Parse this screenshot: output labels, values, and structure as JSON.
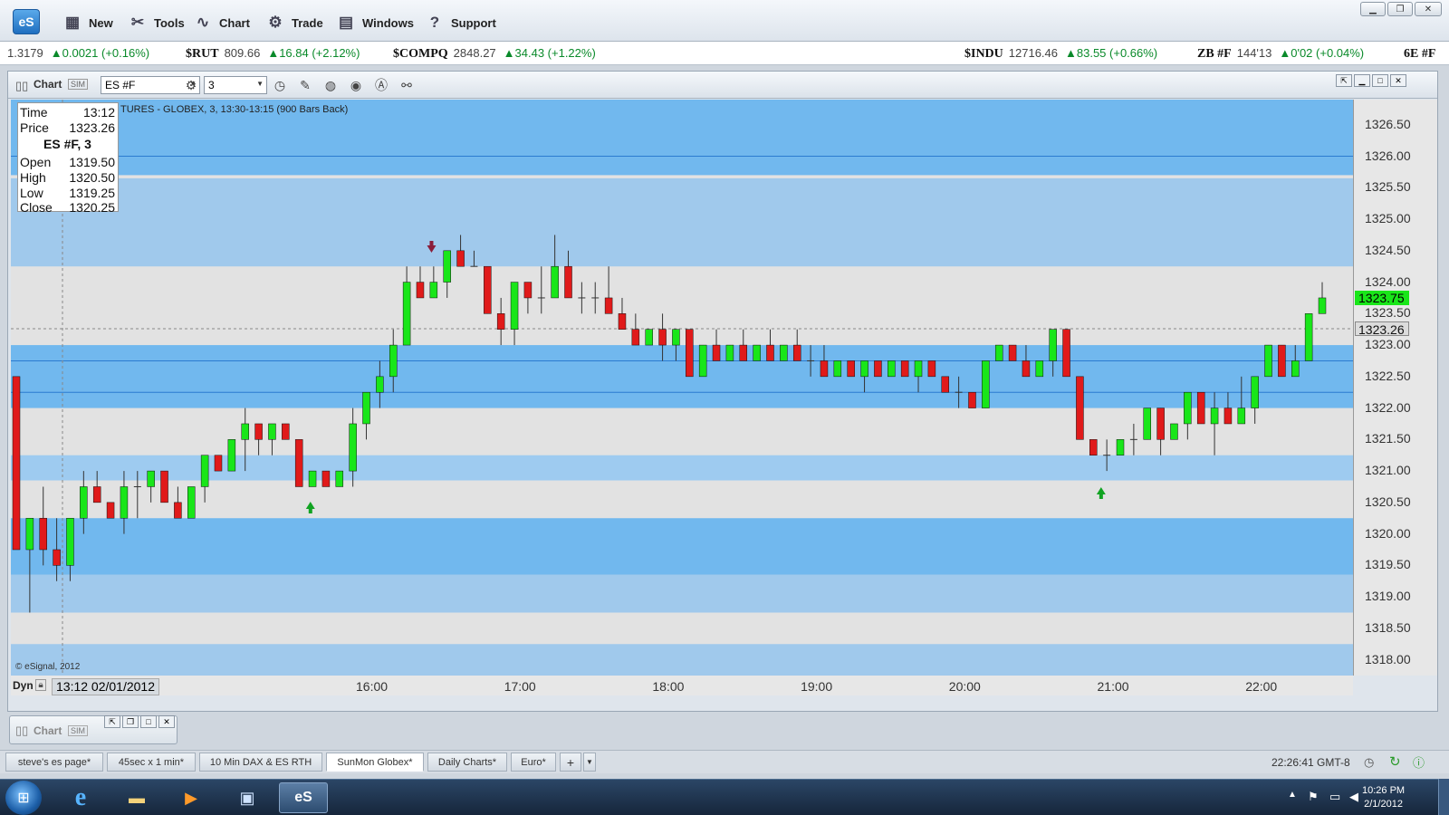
{
  "app": {
    "logo": "eS"
  },
  "menu": [
    {
      "label": "New",
      "icon": "new-chart-icon",
      "glyph": "▦"
    },
    {
      "label": "Tools",
      "icon": "tools-icon",
      "glyph": "✂"
    },
    {
      "label": "Chart",
      "icon": "chart-icon",
      "glyph": "∿"
    },
    {
      "label": "Trade",
      "icon": "trade-icon",
      "glyph": "⚙"
    },
    {
      "label": "Windows",
      "icon": "windows-icon",
      "glyph": "▤"
    },
    {
      "label": "Support",
      "icon": "support-icon",
      "glyph": "?"
    }
  ],
  "ticker": [
    {
      "sym": "",
      "price": "1.3179",
      "chg": "▲0.0021 (+0.16%)"
    },
    {
      "sym": "$RUT",
      "price": "809.66",
      "chg": "▲16.84 (+2.12%)"
    },
    {
      "sym": "$COMPQ",
      "price": "2848.27",
      "chg": "▲34.43 (+1.22%)"
    },
    {
      "sym": "$INDU",
      "price": "12716.46",
      "chg": "▲83.55 (+0.66%)"
    },
    {
      "sym": "ZB #F",
      "price": "144'13",
      "chg": "▲0'02 (+0.04%)"
    },
    {
      "sym": "6E #F",
      "price": "",
      "chg": ""
    }
  ],
  "chart_window": {
    "title": "Chart",
    "symbol": "ES #F",
    "interval": "3",
    "caption": "TURES - GLOBEX, 3, 13:30-13:15 (900 Bars Back)",
    "copyright": "© eSignal, 2012",
    "dyn_label": "Dyn",
    "cursor_time": "13:12 02/01/2012"
  },
  "info_box": {
    "time_label": "Time",
    "time": "13:12",
    "price_label": "Price",
    "price": "1323.26",
    "symbol_line": "ES #F, 3",
    "open_label": "Open",
    "open": "1319.50",
    "high_label": "High",
    "high": "1320.50",
    "low_label": "Low",
    "low": "1319.25",
    "close_label": "Close",
    "close": "1320.25"
  },
  "price_labels": {
    "last": "1323.75",
    "cursor": "1323.26"
  },
  "chart_data": {
    "type": "candlestick",
    "symbol": "ES #F",
    "interval_minutes": 3,
    "ylim": [
      1317.75,
      1326.9
    ],
    "y_ticks": [
      "1326.50",
      "1326.00",
      "1325.50",
      "1325.00",
      "1324.50",
      "1324.00",
      "1323.50",
      "1323.00",
      "1322.50",
      "1322.00",
      "1321.50",
      "1321.00",
      "1320.50",
      "1320.00",
      "1319.50",
      "1319.00",
      "1318.50",
      "1318.00"
    ],
    "x_ticks": [
      "16:00",
      "17:00",
      "18:00",
      "19:00",
      "20:00",
      "21:00",
      "22:00"
    ],
    "bands": [
      {
        "from": 1325.7,
        "to": 1326.9,
        "color": "#71b8ee"
      },
      {
        "from": 1324.25,
        "to": 1325.65,
        "color": "#a0c9ec"
      },
      {
        "from": 1322.0,
        "to": 1323.0,
        "color": "#71b8ee"
      },
      {
        "from": 1320.85,
        "to": 1321.25,
        "color": "#9ecbf0"
      },
      {
        "from": 1319.35,
        "to": 1320.25,
        "color": "#71b8ee"
      },
      {
        "from": 1318.75,
        "to": 1319.35,
        "color": "#a0c9ec"
      },
      {
        "from": 1317.75,
        "to": 1318.25,
        "color": "#a0c9ec"
      }
    ],
    "lines": [
      1322.75,
      1322.25,
      1326.0
    ],
    "markers": [
      {
        "type": "sell",
        "time": "16:24",
        "price": 1324.5
      },
      {
        "type": "buy",
        "time": "15:35",
        "price": 1320.5
      },
      {
        "type": "buy",
        "time": "20:55",
        "price": 1320.75
      }
    ],
    "key_prices": {
      "high": 1324.75,
      "low": 1318.75,
      "last": 1323.75
    },
    "series": [
      {
        "name": "ES #F",
        "ohlc_path": [
          [
            1322.5,
            1322.5,
            1319.75,
            1319.75
          ],
          [
            1319.75,
            1320.25,
            1318.75,
            1320.25
          ],
          [
            1320.25,
            1320.75,
            1319.5,
            1319.75
          ],
          [
            1319.75,
            1320.25,
            1319.25,
            1319.5
          ],
          [
            1319.5,
            1320.0,
            1319.25,
            1320.25
          ],
          [
            1320.25,
            1321.0,
            1320.0,
            1320.75
          ],
          [
            1320.75,
            1321.0,
            1320.5,
            1320.5
          ],
          [
            1320.5,
            1320.5,
            1320.25,
            1320.25
          ],
          [
            1320.25,
            1321.0,
            1320.0,
            1320.75
          ],
          [
            1320.75,
            1321.0,
            1320.25,
            1320.75
          ],
          [
            1320.75,
            1321.0,
            1320.5,
            1321.0
          ],
          [
            1321.0,
            1321.0,
            1320.5,
            1320.5
          ],
          [
            1320.5,
            1320.75,
            1320.25,
            1320.25
          ],
          [
            1320.25,
            1320.75,
            1320.25,
            1320.75
          ],
          [
            1320.75,
            1321.25,
            1320.5,
            1321.25
          ],
          [
            1321.25,
            1321.25,
            1321.0,
            1321.0
          ],
          [
            1321.0,
            1321.5,
            1321.0,
            1321.5
          ],
          [
            1321.5,
            1322.0,
            1321.0,
            1321.75
          ],
          [
            1321.75,
            1321.75,
            1321.25,
            1321.5
          ],
          [
            1321.5,
            1321.75,
            1321.25,
            1321.75
          ],
          [
            1321.75,
            1321.75,
            1321.5,
            1321.5
          ],
          [
            1321.5,
            1321.5,
            1320.75,
            1320.75
          ],
          [
            1320.75,
            1321.0,
            1320.75,
            1321.0
          ],
          [
            1321.0,
            1321.0,
            1320.75,
            1320.75
          ],
          [
            1320.75,
            1321.0,
            1320.75,
            1321.0
          ],
          [
            1321.0,
            1322.0,
            1320.75,
            1321.75
          ],
          [
            1321.75,
            1322.25,
            1321.5,
            1322.25
          ],
          [
            1322.25,
            1322.75,
            1322.0,
            1322.5
          ],
          [
            1322.5,
            1323.25,
            1322.25,
            1323.0
          ],
          [
            1323.0,
            1324.25,
            1323.0,
            1324.0
          ],
          [
            1324.0,
            1324.25,
            1323.75,
            1323.75
          ],
          [
            1323.75,
            1324.25,
            1323.75,
            1324.0
          ],
          [
            1324.0,
            1324.5,
            1323.75,
            1324.5
          ],
          [
            1324.5,
            1324.75,
            1324.25,
            1324.25
          ],
          [
            1324.25,
            1324.5,
            1324.25,
            1324.25
          ],
          [
            1324.25,
            1324.25,
            1323.5,
            1323.5
          ],
          [
            1323.5,
            1323.75,
            1323.0,
            1323.25
          ],
          [
            1323.25,
            1324.0,
            1323.0,
            1324.0
          ],
          [
            1324.0,
            1324.0,
            1323.5,
            1323.75
          ],
          [
            1323.75,
            1324.25,
            1323.5,
            1323.75
          ],
          [
            1323.75,
            1324.75,
            1323.75,
            1324.25
          ],
          [
            1324.25,
            1324.5,
            1323.75,
            1323.75
          ],
          [
            1323.75,
            1324.0,
            1323.5,
            1323.75
          ],
          [
            1323.75,
            1324.0,
            1323.5,
            1323.75
          ],
          [
            1323.75,
            1324.25,
            1323.5,
            1323.5
          ],
          [
            1323.5,
            1323.75,
            1323.25,
            1323.25
          ],
          [
            1323.25,
            1323.5,
            1323.0,
            1323.0
          ],
          [
            1323.0,
            1323.25,
            1323.0,
            1323.25
          ],
          [
            1323.25,
            1323.5,
            1322.75,
            1323.0
          ],
          [
            1323.0,
            1323.25,
            1322.75,
            1323.25
          ],
          [
            1323.25,
            1323.25,
            1322.5,
            1322.5
          ],
          [
            1322.5,
            1323.0,
            1322.5,
            1323.0
          ],
          [
            1323.0,
            1323.25,
            1322.75,
            1322.75
          ],
          [
            1322.75,
            1323.0,
            1322.75,
            1323.0
          ],
          [
            1323.0,
            1323.25,
            1322.75,
            1322.75
          ],
          [
            1322.75,
            1323.0,
            1322.75,
            1323.0
          ],
          [
            1323.0,
            1323.25,
            1322.75,
            1322.75
          ],
          [
            1322.75,
            1323.0,
            1322.75,
            1323.0
          ],
          [
            1323.0,
            1323.25,
            1322.75,
            1322.75
          ],
          [
            1322.75,
            1323.0,
            1322.5,
            1322.75
          ],
          [
            1322.75,
            1323.0,
            1322.5,
            1322.5
          ],
          [
            1322.5,
            1322.75,
            1322.5,
            1322.75
          ],
          [
            1322.75,
            1322.75,
            1322.5,
            1322.5
          ],
          [
            1322.5,
            1322.75,
            1322.25,
            1322.75
          ],
          [
            1322.75,
            1322.75,
            1322.5,
            1322.5
          ],
          [
            1322.5,
            1322.75,
            1322.5,
            1322.75
          ],
          [
            1322.75,
            1322.75,
            1322.5,
            1322.5
          ],
          [
            1322.5,
            1322.75,
            1322.25,
            1322.75
          ],
          [
            1322.75,
            1322.75,
            1322.5,
            1322.5
          ],
          [
            1322.5,
            1322.5,
            1322.25,
            1322.25
          ],
          [
            1322.25,
            1322.5,
            1322.0,
            1322.25
          ],
          [
            1322.25,
            1322.25,
            1322.0,
            1322.0
          ],
          [
            1322.0,
            1322.75,
            1322.0,
            1322.75
          ],
          [
            1322.75,
            1323.0,
            1322.75,
            1323.0
          ],
          [
            1323.0,
            1323.0,
            1322.75,
            1322.75
          ],
          [
            1322.75,
            1323.0,
            1322.5,
            1322.5
          ],
          [
            1322.5,
            1322.75,
            1322.5,
            1322.75
          ],
          [
            1322.75,
            1323.25,
            1322.5,
            1323.25
          ],
          [
            1323.25,
            1323.25,
            1322.5,
            1322.5
          ],
          [
            1322.5,
            1322.5,
            1321.5,
            1321.5
          ],
          [
            1321.5,
            1321.5,
            1321.25,
            1321.25
          ],
          [
            1321.25,
            1321.5,
            1321.0,
            1321.25
          ],
          [
            1321.25,
            1321.5,
            1321.25,
            1321.5
          ],
          [
            1321.5,
            1321.75,
            1321.25,
            1321.5
          ],
          [
            1321.5,
            1322.0,
            1321.5,
            1322.0
          ],
          [
            1322.0,
            1322.0,
            1321.25,
            1321.5
          ],
          [
            1321.5,
            1321.75,
            1321.5,
            1321.75
          ],
          [
            1321.75,
            1322.25,
            1321.5,
            1322.25
          ],
          [
            1322.25,
            1322.25,
            1321.75,
            1321.75
          ],
          [
            1321.75,
            1322.25,
            1321.25,
            1322.0
          ],
          [
            1322.0,
            1322.25,
            1321.75,
            1321.75
          ],
          [
            1321.75,
            1322.5,
            1321.75,
            1322.0
          ],
          [
            1322.0,
            1322.5,
            1321.75,
            1322.5
          ],
          [
            1322.5,
            1323.0,
            1322.5,
            1323.0
          ],
          [
            1323.0,
            1323.0,
            1322.5,
            1322.5
          ],
          [
            1322.5,
            1323.0,
            1322.5,
            1322.75
          ],
          [
            1322.75,
            1323.5,
            1322.75,
            1323.5
          ],
          [
            1323.5,
            1324.0,
            1323.5,
            1323.75
          ]
        ]
      }
    ]
  },
  "mini_chart": {
    "title": "Chart"
  },
  "tabs": [
    {
      "label": "steve's es page*"
    },
    {
      "label": "45sec x 1 min*"
    },
    {
      "label": "10 Min DAX & ES RTH"
    },
    {
      "label": "SunMon Globex*",
      "active": true
    },
    {
      "label": "Daily Charts*"
    },
    {
      "label": "Euro*"
    }
  ],
  "status": {
    "clock": "22:26:41 GMT-8"
  },
  "taskbar": {
    "apps": [
      {
        "name": "ie-icon",
        "glyph": "e"
      },
      {
        "name": "folder-icon",
        "glyph": "▬"
      },
      {
        "name": "media-player-icon",
        "glyph": "▶"
      },
      {
        "name": "computer-icon",
        "glyph": "▣"
      },
      {
        "name": "esignal-task-icon",
        "glyph": "eS"
      }
    ],
    "time": "10:26 PM",
    "date": "2/1/2012"
  }
}
